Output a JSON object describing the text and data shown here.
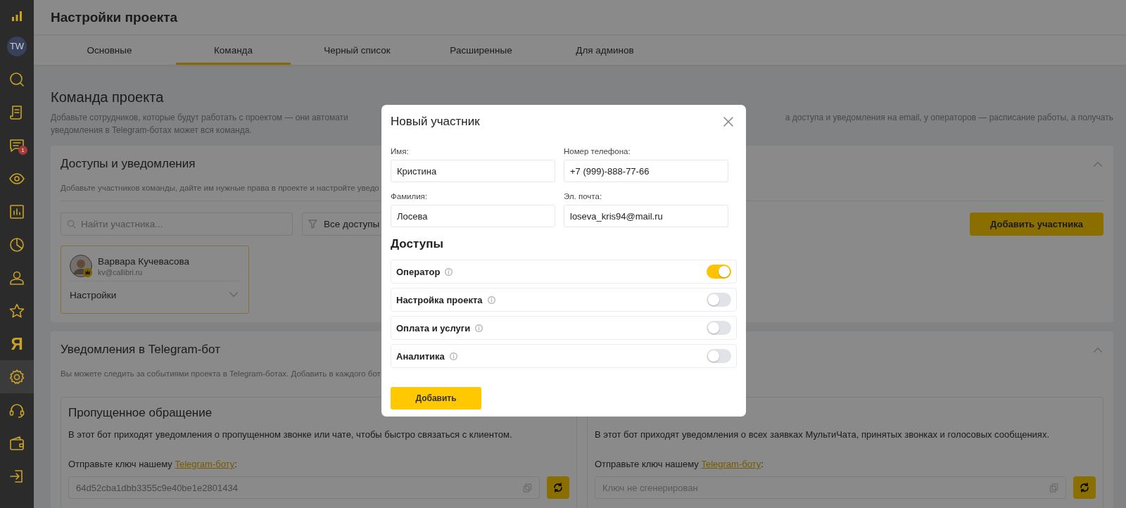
{
  "sidebar": {
    "items": [
      {
        "kind": "logo",
        "selected": false
      },
      {
        "kind": "avatar",
        "label": "TW",
        "selected": false
      },
      {
        "kind": "search",
        "selected": false
      },
      {
        "kind": "document",
        "selected": false
      },
      {
        "kind": "chat",
        "badge": "1",
        "selected": false
      },
      {
        "kind": "eye",
        "selected": false
      },
      {
        "kind": "chart",
        "selected": false
      },
      {
        "kind": "pie",
        "selected": false
      },
      {
        "kind": "person",
        "selected": false
      },
      {
        "kind": "star",
        "selected": false
      },
      {
        "kind": "letter",
        "label": "Я",
        "selected": false
      },
      {
        "kind": "gear",
        "selected": true
      },
      {
        "kind": "headset",
        "selected": false
      },
      {
        "kind": "wallet",
        "selected": false
      },
      {
        "kind": "logout",
        "selected": false
      }
    ]
  },
  "header": {
    "title": "Настройки проекта"
  },
  "tabs": [
    {
      "label": "Основные",
      "selected": false
    },
    {
      "label": "Команда",
      "selected": true
    },
    {
      "label": "Черный список",
      "selected": false
    },
    {
      "label": "Расширенные",
      "selected": false
    },
    {
      "label": "Для админов",
      "selected": false
    }
  ],
  "page": {
    "title": "Команда проекта",
    "intro_left": "Добавьте сотрудников, которые будут работать с проектом — они автомати",
    "intro_right": "а доступа и уведомления на email, у операторов — расписание работы, а получать",
    "intro_line2": "уведомления в Telegram-ботах может вся команда."
  },
  "access_card": {
    "title": "Доступы и уведомления",
    "expanded": true,
    "subtitle": "Добавьте участников команды, дайте им нужные права в проекте и настройте уведо",
    "search": {
      "placeholder": "Найти участника..."
    },
    "filter": {
      "value": "Все доступы"
    },
    "add_button": "Добавить участника",
    "members": [
      {
        "name": "Варвара Кучевасова",
        "email": "kv@callibri.ru",
        "owner": true,
        "settings_label": "Настройки",
        "expanded": false
      }
    ]
  },
  "telegram_card": {
    "title": "Уведомления в Telegram-бот",
    "expanded": true,
    "subtitle": "Вы можете следить за событиями проекта в Telegram-ботах. Добавить в каждого бот",
    "bots": [
      {
        "title": "Пропущенное обращение",
        "description": "В этот бот приходят уведомления о пропущенном звонке или чате, чтобы быстро связаться с клиентом.",
        "instruction": "Отправьте ключ нашему ",
        "link": "Telegram-боту",
        "instruction_end": ":",
        "key": {
          "value": "64d52cba1dbb3355c9e40be1e2801434"
        }
      },
      {
        "description": "В этот бот приходят уведомления о всех заявках МультиЧата, принятых звонках и голосовых сообщениях.",
        "instruction": "Отправьте ключ нашему ",
        "link": "Telegram-боту",
        "instruction_end": ":",
        "key": {
          "placeholder": "Ключ не сгенерирован"
        }
      }
    ]
  },
  "modal": {
    "title": "Новый участник",
    "fields": [
      {
        "label": "Имя:",
        "value": "Кристина"
      },
      {
        "label": "Номер телефона:",
        "value": "+7 (999)-888-77-66"
      },
      {
        "label": "Фамилия:",
        "value": "Лосева"
      },
      {
        "label": "Эл. почта:",
        "value": "loseva_kris94@mail.ru"
      }
    ],
    "section_title": "Доступы",
    "permissions": [
      {
        "label": "Оператор",
        "on": true
      },
      {
        "label": "Настройка проекта",
        "on": false
      },
      {
        "label": "Оплата и услуги",
        "on": false
      },
      {
        "label": "Аналитика",
        "on": false
      }
    ],
    "submit": "Добавить"
  }
}
